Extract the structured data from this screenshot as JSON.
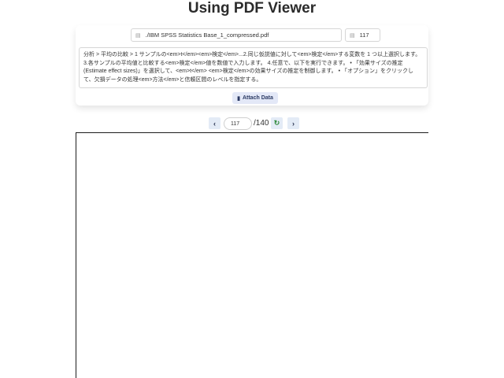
{
  "header": {
    "title": "Using PDF Viewer"
  },
  "file": {
    "path": "./IBM SPSS Statistics Base_1_compressed.pdf",
    "icon": "file-icon"
  },
  "page_field": {
    "value": "117",
    "icon": "page-icon"
  },
  "search_text": "分析 > 平均の比較 > 1 サンプルの<em>t</em><em>検定</em>...2.同じ仮説値に対して<em>検定</em>する変数を 1 つ以上選択します。 3.各サンプルの平均値と比較する<em>検定</em>値を数値で入力します。 4.任意で、以下を実行できます。 • 「効果サイズの推定 (Estimate effect sizes)」を選択して、<em>t</em> <em>検定</em>の効果サイズの推定を制御します。 • 「オプション」をクリックして、欠損データの処理<em>方法</em>と信頼区間のレベルを指定する。",
  "attach": {
    "label": "Attach Data",
    "icon": "document-icon"
  },
  "nav": {
    "prev_icon": "chevron-left-icon",
    "next_icon": "chevron-right-icon",
    "reload_icon": "reload-icon",
    "current_page": "117",
    "total_pages": "/140"
  },
  "colors": {
    "accent_button": "#e3e8f7",
    "nav_button": "#e3ebf6",
    "reload_green": "#2e8a3b"
  }
}
